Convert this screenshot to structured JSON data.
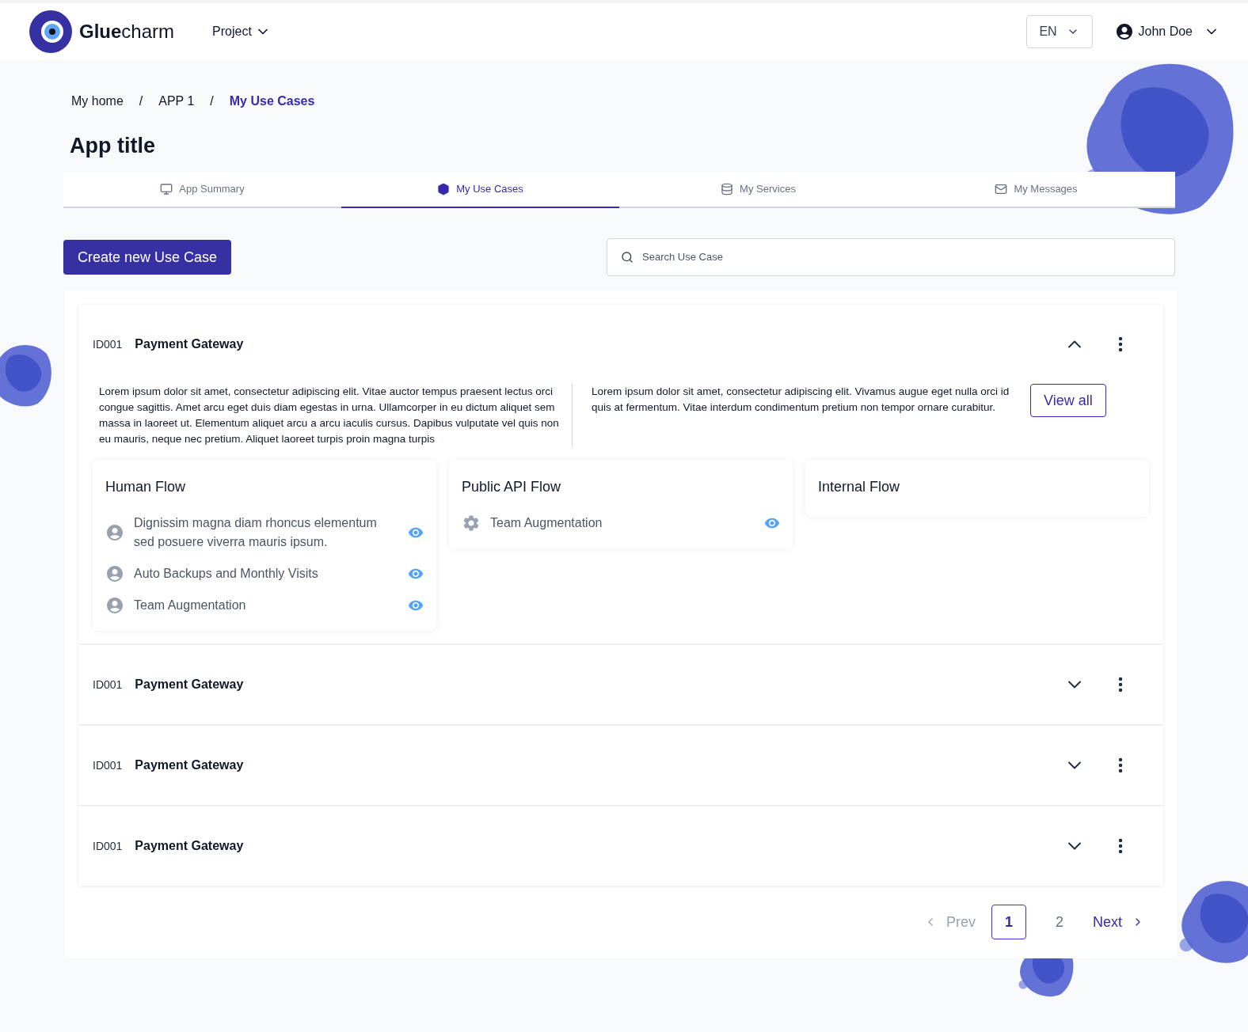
{
  "header": {
    "logo": "**Glue**charm",
    "project_menu": "Project",
    "language": "EN",
    "user": "John Doe"
  },
  "breadcrumb": [
    {
      "label": "My home",
      "current": false
    },
    {
      "separator": "/",
      "label": "APP 1",
      "current": false
    },
    {
      "separator": "/",
      "label": "My Use Cases",
      "current": true
    }
  ],
  "title": "App title",
  "tabs": [
    {
      "label": "App Summary",
      "selected": false
    },
    {
      "label": "My Use Cases",
      "selected": true
    },
    {
      "label": "My Services",
      "selected": false
    },
    {
      "label": "My Messages",
      "selected": false
    }
  ],
  "create_button": "Create new Use Case",
  "search": {
    "placeholder": "Search Use Case"
  },
  "use_cases": [
    {
      "id": "ID001",
      "name": "Payment Gateway",
      "expanded": true,
      "description_left": "Lorem ipsum dolor sit amet, consectetur adipiscing elit. Vitae auctor tempus praesent lectus orci congue sagittis. Amet arcu eget duis diam egestas in urna. Ullamcorper in eu dictum aliquet sem massa in laoreet ut. Elementum aliquet arcu a arcu iaculis cursus. Dapibus vulputate vel quis non eu mauris, neque nec pretium. Aliquet laoreet turpis proin magna turpis",
      "description_right": "Lorem ipsum dolor sit amet, consectetur adipiscing elit. Vivamus augue eget nulla orci id quis at fermentum. Vitae interdum condimentum pretium non tempor ornare curabitur.",
      "view_all": "View all",
      "flows": [
        {
          "title": "Human Flow",
          "items": [
            {
              "text": "Dignissim magna diam rhoncus elementum sed posuere viverra mauris ipsum.",
              "kind": "person"
            },
            {
              "text": "Auto Backups and Monthly Visits",
              "kind": "person"
            },
            {
              "text": "Team Augmentation",
              "kind": "person"
            }
          ]
        },
        {
          "title": "Public API Flow",
          "items": [
            {
              "text": "Team Augmentation",
              "kind": "gear"
            }
          ]
        },
        {
          "title": "Internal Flow"
        }
      ]
    },
    {
      "id": "ID001",
      "name": "Payment Gateway",
      "expanded": false
    },
    {
      "id": "ID001",
      "name": "Payment Gateway",
      "expanded": false
    },
    {
      "id": "ID001",
      "name": "Payment Gateway",
      "expanded": false
    }
  ],
  "pagination": {
    "prev": {
      "label": "Prev",
      "disabled": true
    },
    "pages": [
      {
        "label": "1",
        "selected": true
      },
      {
        "label": "2",
        "selected": false
      }
    ],
    "next": {
      "label": "Next",
      "disabled": false
    }
  }
}
